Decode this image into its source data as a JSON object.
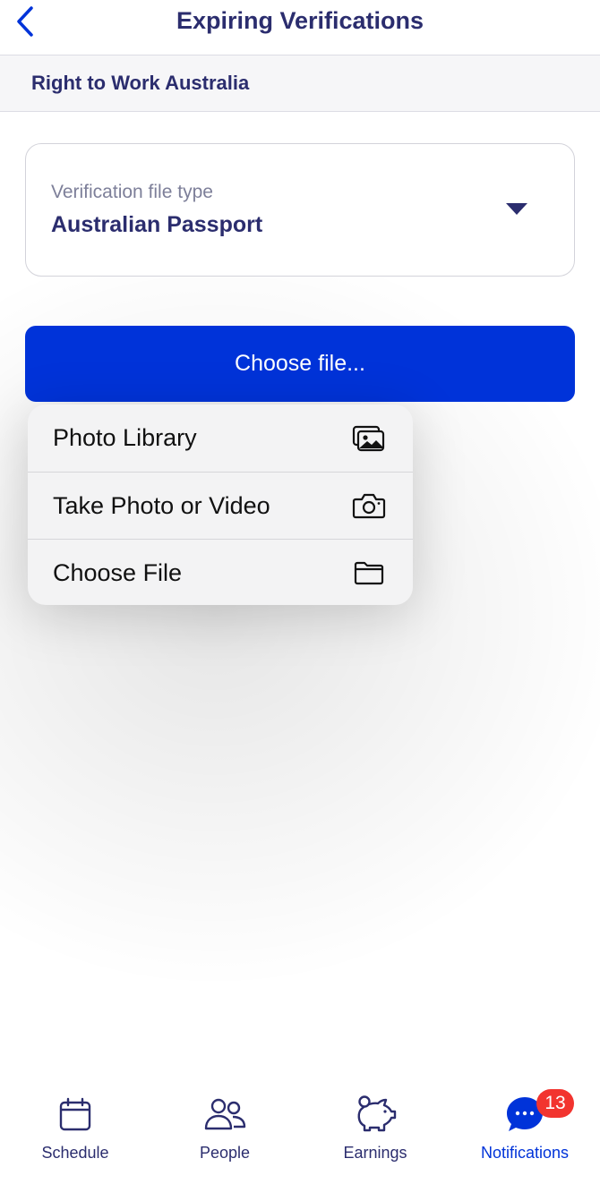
{
  "header": {
    "title": "Expiring Verifications",
    "back_icon": "chevron-left-icon"
  },
  "section": {
    "label": "Right to Work Australia"
  },
  "file_type_select": {
    "label": "Verification file type",
    "value": "Australian Passport",
    "icon": "caret-down-icon"
  },
  "choose_button": {
    "label": "Choose file..."
  },
  "file_source_menu": {
    "items": [
      {
        "label": "Photo Library",
        "icon": "photo-library-icon"
      },
      {
        "label": "Take Photo or Video",
        "icon": "camera-icon"
      },
      {
        "label": "Choose File",
        "icon": "folder-icon"
      }
    ]
  },
  "tabbar": {
    "tabs": [
      {
        "label": "Schedule",
        "icon": "calendar-icon"
      },
      {
        "label": "People",
        "icon": "people-icon"
      },
      {
        "label": "Earnings",
        "icon": "piggy-bank-icon"
      },
      {
        "label": "Notifications",
        "icon": "chat-bubble-icon",
        "badge": "13",
        "active": true
      }
    ]
  },
  "colors": {
    "primary": "#0033d9",
    "text_navy": "#2b2d6e",
    "badge": "#f2342f"
  }
}
